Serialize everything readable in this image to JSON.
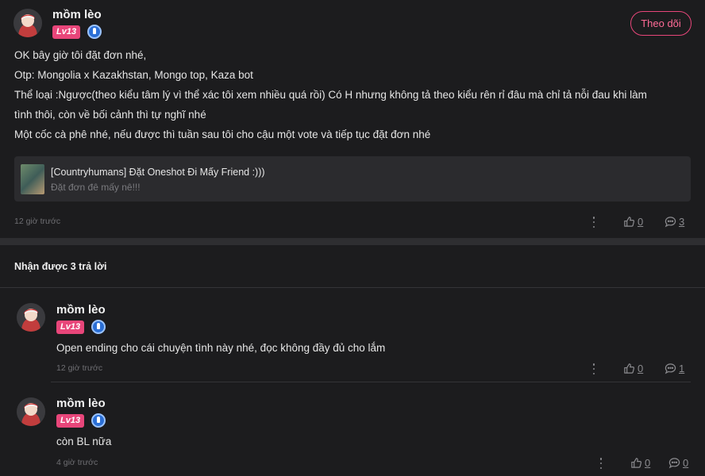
{
  "post": {
    "author": "mồm lèo",
    "level": "Lv13",
    "follow_label": "Theo dõi",
    "lines": [
      "OK bây giờ tôi đặt đơn nhé,",
      "Otp: Mongolia x Kazakhstan, Mongo top, Kaza bot",
      "Thể loại :Ngược(theo kiểu tâm lý vì thể xác tôi xem nhiều quá rồi) Có H nhưng không tả theo kiểu rên rỉ đâu mà chỉ tả nỗi đau khi làm",
      "tình thôi, còn về bối cảnh thì tự nghĩ nhé",
      "Một cốc cà phê nhé, nếu được thì tuần sau tôi cho cậu một vote và tiếp tục đặt đơn nhé"
    ],
    "link": {
      "title": "[Countryhumans] Đặt Oneshot Đi Mấy Friend :)))",
      "subtitle": "Đặt đơn đê mấy nê!!!"
    },
    "time": "12 giờ trước",
    "likes": "0",
    "comments": "3"
  },
  "replies_title": "Nhận được 3 trả lời",
  "replies": [
    {
      "author": "mồm lèo",
      "level": "Lv13",
      "text": "Open ending cho cái chuyện tình này nhé, đọc không đầy đủ cho lắm",
      "time": "12 giờ trước",
      "likes": "0",
      "comments": "1"
    },
    {
      "author": "mồm lèo",
      "level": "Lv13",
      "text": "còn BL nữa",
      "time": "4 giờ trước",
      "likes": "0",
      "comments": "0"
    }
  ],
  "icons": {
    "more": "more-vertical-icon",
    "like": "thumb-up-icon",
    "comment": "comment-bubble-icon",
    "badge": "vip-badge-icon"
  },
  "colors": {
    "background": "#1c1c1e",
    "accent": "#e8467a",
    "badge_blue": "#2b6fd6"
  }
}
